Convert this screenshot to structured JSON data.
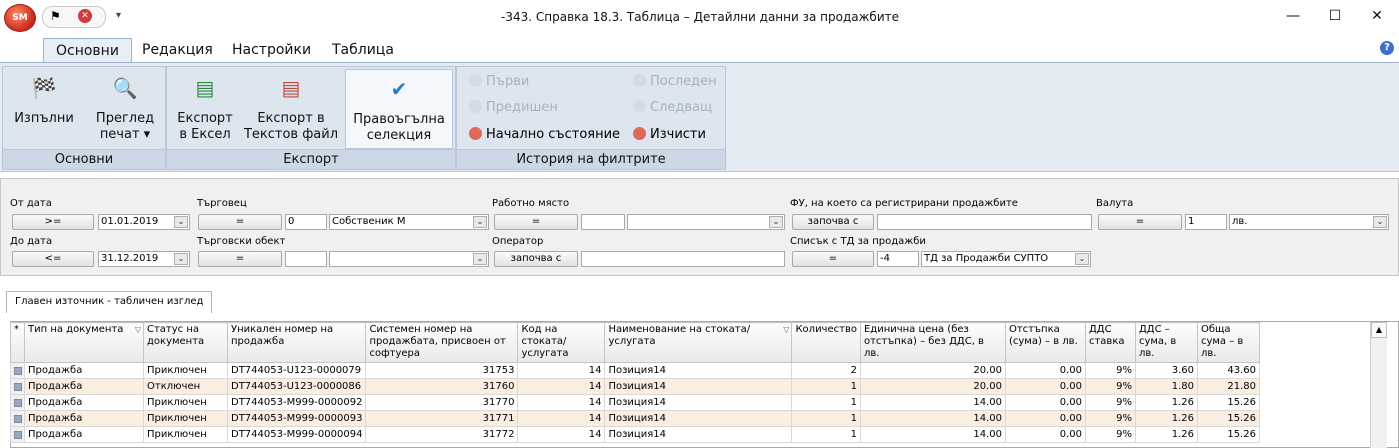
{
  "window": {
    "title": "-343. Справка 18.3. Таблица – Детайлни данни за продажбите",
    "orb_label": "SM",
    "minimize": "—",
    "maximize": "☐",
    "close": "✕"
  },
  "ribbon": {
    "tabs": [
      "Основни",
      "Редакция",
      "Настройки",
      "Таблица"
    ],
    "active_tab": "Основни",
    "groups": {
      "main": {
        "label": "Основни",
        "execute": "Изпълни",
        "preview_line1": "Преглед",
        "preview_line2": "печат ▾"
      },
      "export": {
        "label": "Експорт",
        "excel_line1": "Експорт",
        "excel_line2": "в Ексел",
        "text_line1": "Експорт в",
        "text_line2": "Текстов файл",
        "rect_line1": "Правоъгълна",
        "rect_line2": "селекция"
      },
      "history": {
        "label": "История на филтрите",
        "first": "Първи",
        "last": "Последен",
        "previous": "Предишен",
        "next": "Следващ",
        "initial_state": "Начално състояние",
        "clear": "Изчисти"
      }
    }
  },
  "filters": {
    "from_date": {
      "label": "От дата",
      "op": ">=",
      "value": "01.01.2019"
    },
    "to_date": {
      "label": "До дата",
      "op": "<=",
      "value": "31.12.2019"
    },
    "dealer": {
      "label": "Търговец",
      "op": "=",
      "code": "0",
      "name": "Собственик М"
    },
    "dealer_object": {
      "label": "Търговски обект",
      "op": "=",
      "code": "",
      "name": ""
    },
    "workplace": {
      "label": "Работно място",
      "op": "=",
      "code": "",
      "name": ""
    },
    "operator": {
      "label": "Оператор",
      "op": "започва с",
      "value": ""
    },
    "fu": {
      "label": "ФУ, на което са регистрирани продажбите",
      "op": "започва с",
      "value": ""
    },
    "td_list": {
      "label": "Списък с ТД за продажби",
      "op": "=",
      "code": "-4",
      "name": "ТД за Продажби СУПТО"
    },
    "currency": {
      "label": "Валута",
      "op": "=",
      "code": "1",
      "name": "лв."
    }
  },
  "data_tab": "Главен източник - табличен изглед",
  "grid": {
    "columns": [
      "Тип на документа",
      "Статус на документа",
      "Уникален номер на продажба",
      "Системен номер на продажбата, присвоен от софтуера",
      "Код на стоката/услугата",
      "Наименование на стоката/услугата",
      "Количество",
      "Единична цена (без отстъпка) – без ДДС, в лв.",
      "Отстъпка (сума) – в лв.",
      "ДДС ставка",
      "ДДС – сума, в лв.",
      "Обща сума – в лв."
    ],
    "rows": [
      [
        "Продажба",
        "Приключен",
        "DT744053-U123-0000079",
        "31753",
        "14",
        "Позиция14",
        "2",
        "20.00",
        "0.00",
        "9%",
        "3.60",
        "43.60"
      ],
      [
        "Продажба",
        "Отключен",
        "DT744053-U123-0000086",
        "31760",
        "14",
        "Позиция14",
        "1",
        "20.00",
        "0.00",
        "9%",
        "1.80",
        "21.80"
      ],
      [
        "Продажба",
        "Приключен",
        "DT744053-M999-0000092",
        "31770",
        "14",
        "Позиция14",
        "1",
        "14.00",
        "0.00",
        "9%",
        "1.26",
        "15.26"
      ],
      [
        "Продажба",
        "Приключен",
        "DT744053-M999-0000093",
        "31771",
        "14",
        "Позиция14",
        "1",
        "14.00",
        "0.00",
        "9%",
        "1.26",
        "15.26"
      ],
      [
        "Продажба",
        "Приключен",
        "DT744053-M999-0000094",
        "31772",
        "14",
        "Позиция14",
        "1",
        "14.00",
        "0.00",
        "9%",
        "1.26",
        "15.26"
      ]
    ]
  }
}
